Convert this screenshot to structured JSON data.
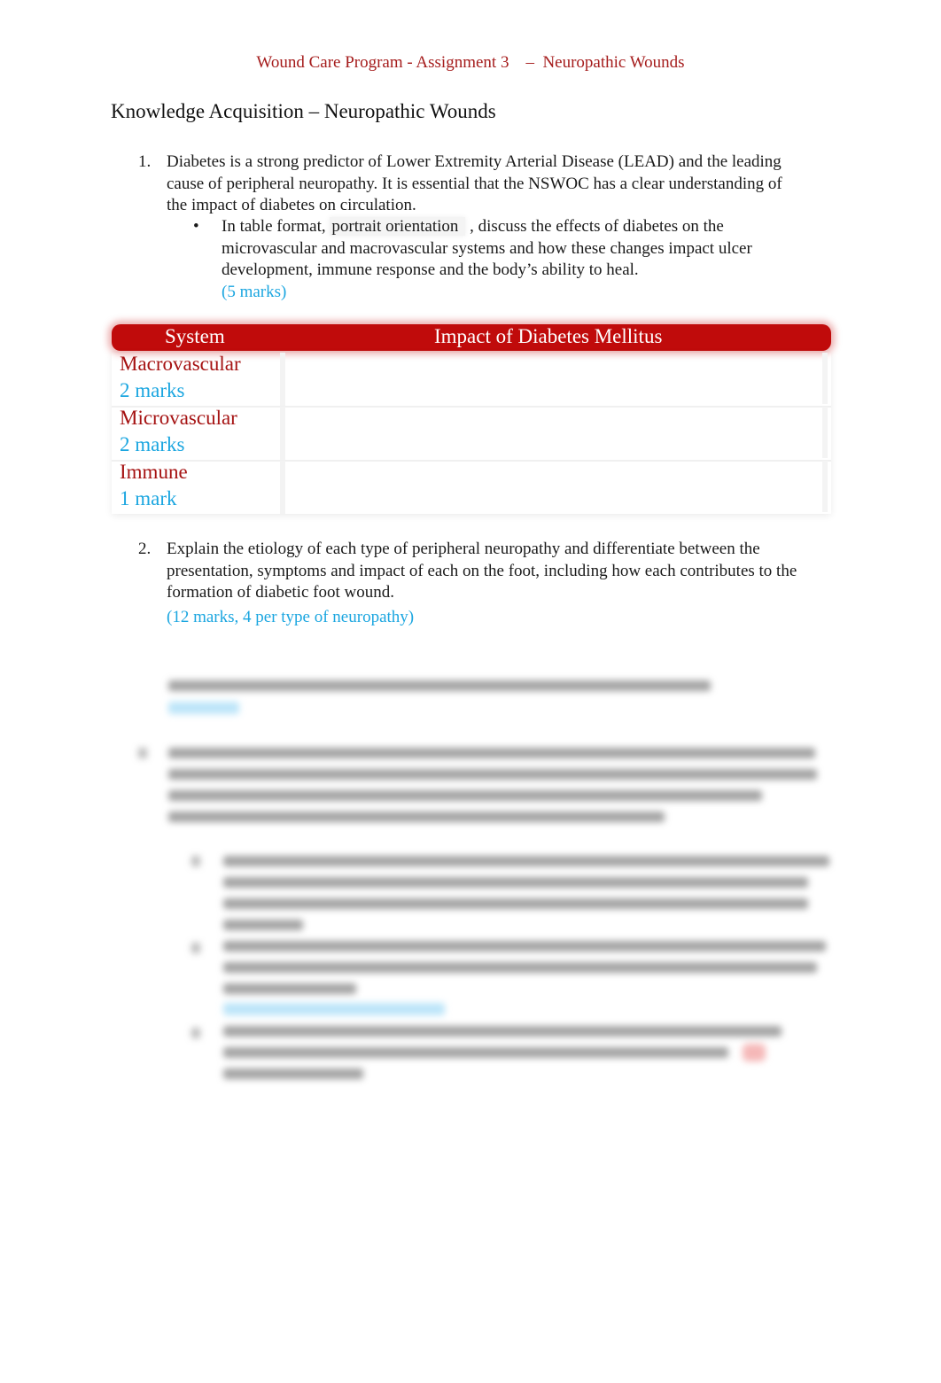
{
  "header": {
    "title": "Wound Care Program - Assignment 3    –  Neuropathic Wounds"
  },
  "section": {
    "title": "Knowledge Acquisition – Neuropathic Wounds"
  },
  "questions": [
    {
      "number": "1.",
      "text": "Diabetes is a strong predictor of Lower Extremity Arterial Disease (LEAD) and the leading cause of peripheral neuropathy. It is essential that the NSWOC has a clear understanding of the impact of diabetes on circulation.",
      "bullet": {
        "symbol": "•",
        "prefix": "In table format, ",
        "highlight": "portrait orientation",
        "suffix": " , discuss the effects of diabetes on the microvascular and macrovascular systems and how these changes impact ulcer development, immune response and the body’s ability to heal.",
        "marks": "(5 marks)"
      }
    },
    {
      "number": "2.",
      "text": "Explain the etiology of each type of peripheral neuropathy and differentiate between the presentation, symptoms and impact of each on the foot, including how each contributes to the formation of diabetic foot wound.",
      "marks": "(12 marks, 4 per type of neuropathy)"
    }
  ],
  "table": {
    "headers": [
      "System",
      "Impact of Diabetes Mellitus"
    ],
    "rows": [
      {
        "system": "Macrovascular",
        "marks": "2 marks",
        "impact": ""
      },
      {
        "system": "Microvascular",
        "marks": "2 marks",
        "impact": ""
      },
      {
        "system": "Immune",
        "marks": "1 mark",
        "impact": ""
      }
    ]
  },
  "colors": {
    "header_red": "#a51c1c",
    "table_header_bg": "#c00b0b",
    "marks_blue": "#1ba6e0",
    "system_red": "#a51212"
  },
  "obscured": {
    "note": "Remaining content blurred"
  }
}
